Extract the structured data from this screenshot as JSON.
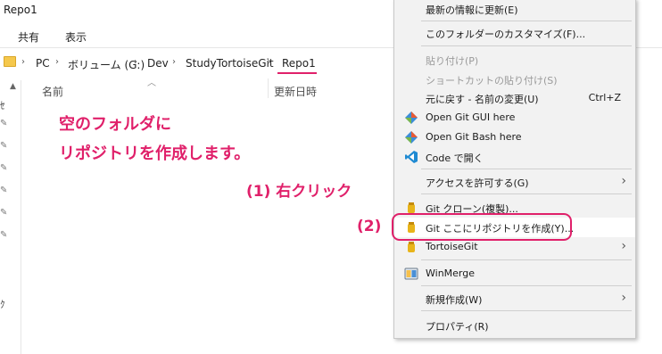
{
  "window": {
    "title": "Repo1"
  },
  "ribbon": {
    "tabs": [
      "共有",
      "表示"
    ]
  },
  "address": {
    "crumbs": [
      "PC",
      "ボリューム (G:)",
      "Dev",
      "StudyTortoiseGit",
      "Repo1"
    ]
  },
  "columns": {
    "name": "名前",
    "modified": "更新日時"
  },
  "leftnav": {
    "fragment_top": "ｾ",
    "fragment_bottom": "ｸ"
  },
  "annotations": {
    "line1": "空のフォルダに",
    "line2": "リポジトリを作成します。",
    "step1": "(1) 右クリック",
    "step2": "(2)"
  },
  "context_menu": {
    "items": [
      {
        "label": "最新の情報に更新(E)"
      },
      {
        "label": "このフォルダーのカスタマイズ(F)..."
      },
      {
        "label": "貼り付け(P)",
        "disabled": true
      },
      {
        "label": "ショートカットの貼り付け(S)",
        "disabled": true
      },
      {
        "label": "元に戻す - 名前の変更(U)",
        "shortcut": "Ctrl+Z"
      },
      {
        "label": "Open Git GUI here",
        "icon": "git-diamond-icon"
      },
      {
        "label": "Open Git Bash here",
        "icon": "git-diamond-icon"
      },
      {
        "label": "Code で開く",
        "icon": "vscode-icon"
      },
      {
        "label": "アクセスを許可する(G)",
        "submenu": true
      },
      {
        "label": "Git クローン(複製)...",
        "icon": "tortoisegit-icon"
      },
      {
        "label": "Git ここにリポジトリを作成(Y)...",
        "icon": "tortoisegit-icon"
      },
      {
        "label": "TortoiseGit",
        "icon": "tortoisegit-icon",
        "submenu": true
      },
      {
        "label": "WinMerge",
        "icon": "winmerge-icon"
      },
      {
        "label": "新規作成(W)",
        "submenu": true
      },
      {
        "label": "プロパティ(R)"
      }
    ]
  },
  "colors": {
    "accent": "#e0206a",
    "menu_bg": "#f2f2f2"
  }
}
